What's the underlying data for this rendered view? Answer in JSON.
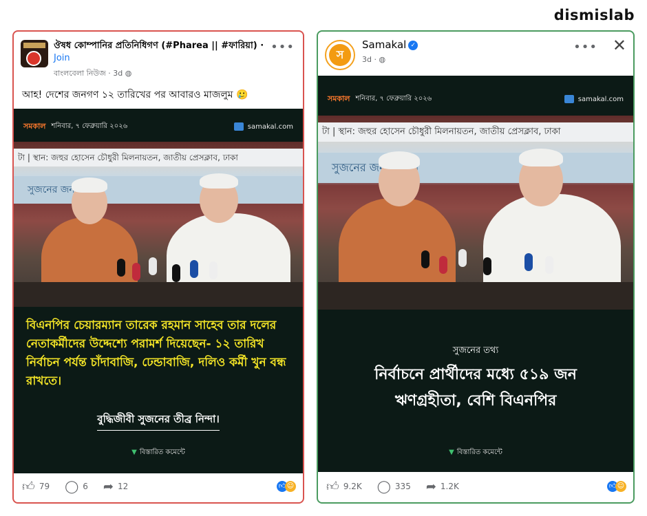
{
  "brand": "dismislab",
  "left_post": {
    "group_name": "ঔষধ কোম্পানির প্রতিনিধিগণ (#Pharea || #ফারিয়া)",
    "join": "Join",
    "author": "বাংলবেলা নিউজ",
    "time": "3d",
    "caption": "আহ! দেশের জনগণ ১২ তারিখের পর আবারও মাজলুম 🥲",
    "image": {
      "logo": "সমকাল",
      "date": "শনিবার, ৭ ফেব্রুয়ারি ২০২৬",
      "site": "samakal.com",
      "banner_top": "টা | স্থান: জহুর হোসেন চৌধুরী মিলনায়তন, জাতীয় প্রেসক্লাব, ঢাকা",
      "banner_mid": "সুজনের জন্য নাগরি",
      "quote": "বিএনপির চেয়ারম্যান তারেক রহমান সাহেব তার দলের নেতাকর্মীদের উদ্দেশ্যে পরামর্শ দিয়েছেন- ১২ তারিখ নির্বাচন পর্যন্ত চাঁদাবাজি, ঢেন্ডাবাজি, দলিও কর্মী খুন বন্ধ রাখতে।",
      "sub": "বুদ্ধিজীবী সুজনের তীব্র নিন্দা।",
      "more": "বিস্তারিত কমেন্টে"
    },
    "likes": "79",
    "comments": "6",
    "shares": "12"
  },
  "right_post": {
    "page_name": "Samakal",
    "time": "3d",
    "image": {
      "logo": "সমকাল",
      "date": "শনিবার, ৭ ফেব্রুয়ারি ২০২৬",
      "site": "samakal.com",
      "banner_top": "টা | স্থান: জহুর হোসেন চৌধুরী মিলনায়তন, জাতীয় প্রেসক্লাব, ঢাকা",
      "banner_mid": "সুজনের জন্য নাগরি",
      "label": "সুজনের তথ্য",
      "headline_1": "নির্বাচনে প্রার্থীদের মধ্যে ৫১৯ জন",
      "headline_2": "ঋণগ্রহীতা, বেশি বিএনপির",
      "more": "বিস্তারিত কমেন্টে"
    },
    "likes": "9.2K",
    "comments": "335",
    "shares": "1.2K"
  },
  "colors": {
    "left_border": "#d9534f",
    "right_border": "#4a9b5f",
    "quote_yellow": "#f5e627",
    "link_blue": "#1877f2"
  },
  "icons": [
    "more-dots-icon",
    "close-icon",
    "globe-icon",
    "verified-icon",
    "like-icon",
    "comment-icon",
    "share-icon",
    "reaction-like-icon",
    "reaction-haha-icon"
  ]
}
